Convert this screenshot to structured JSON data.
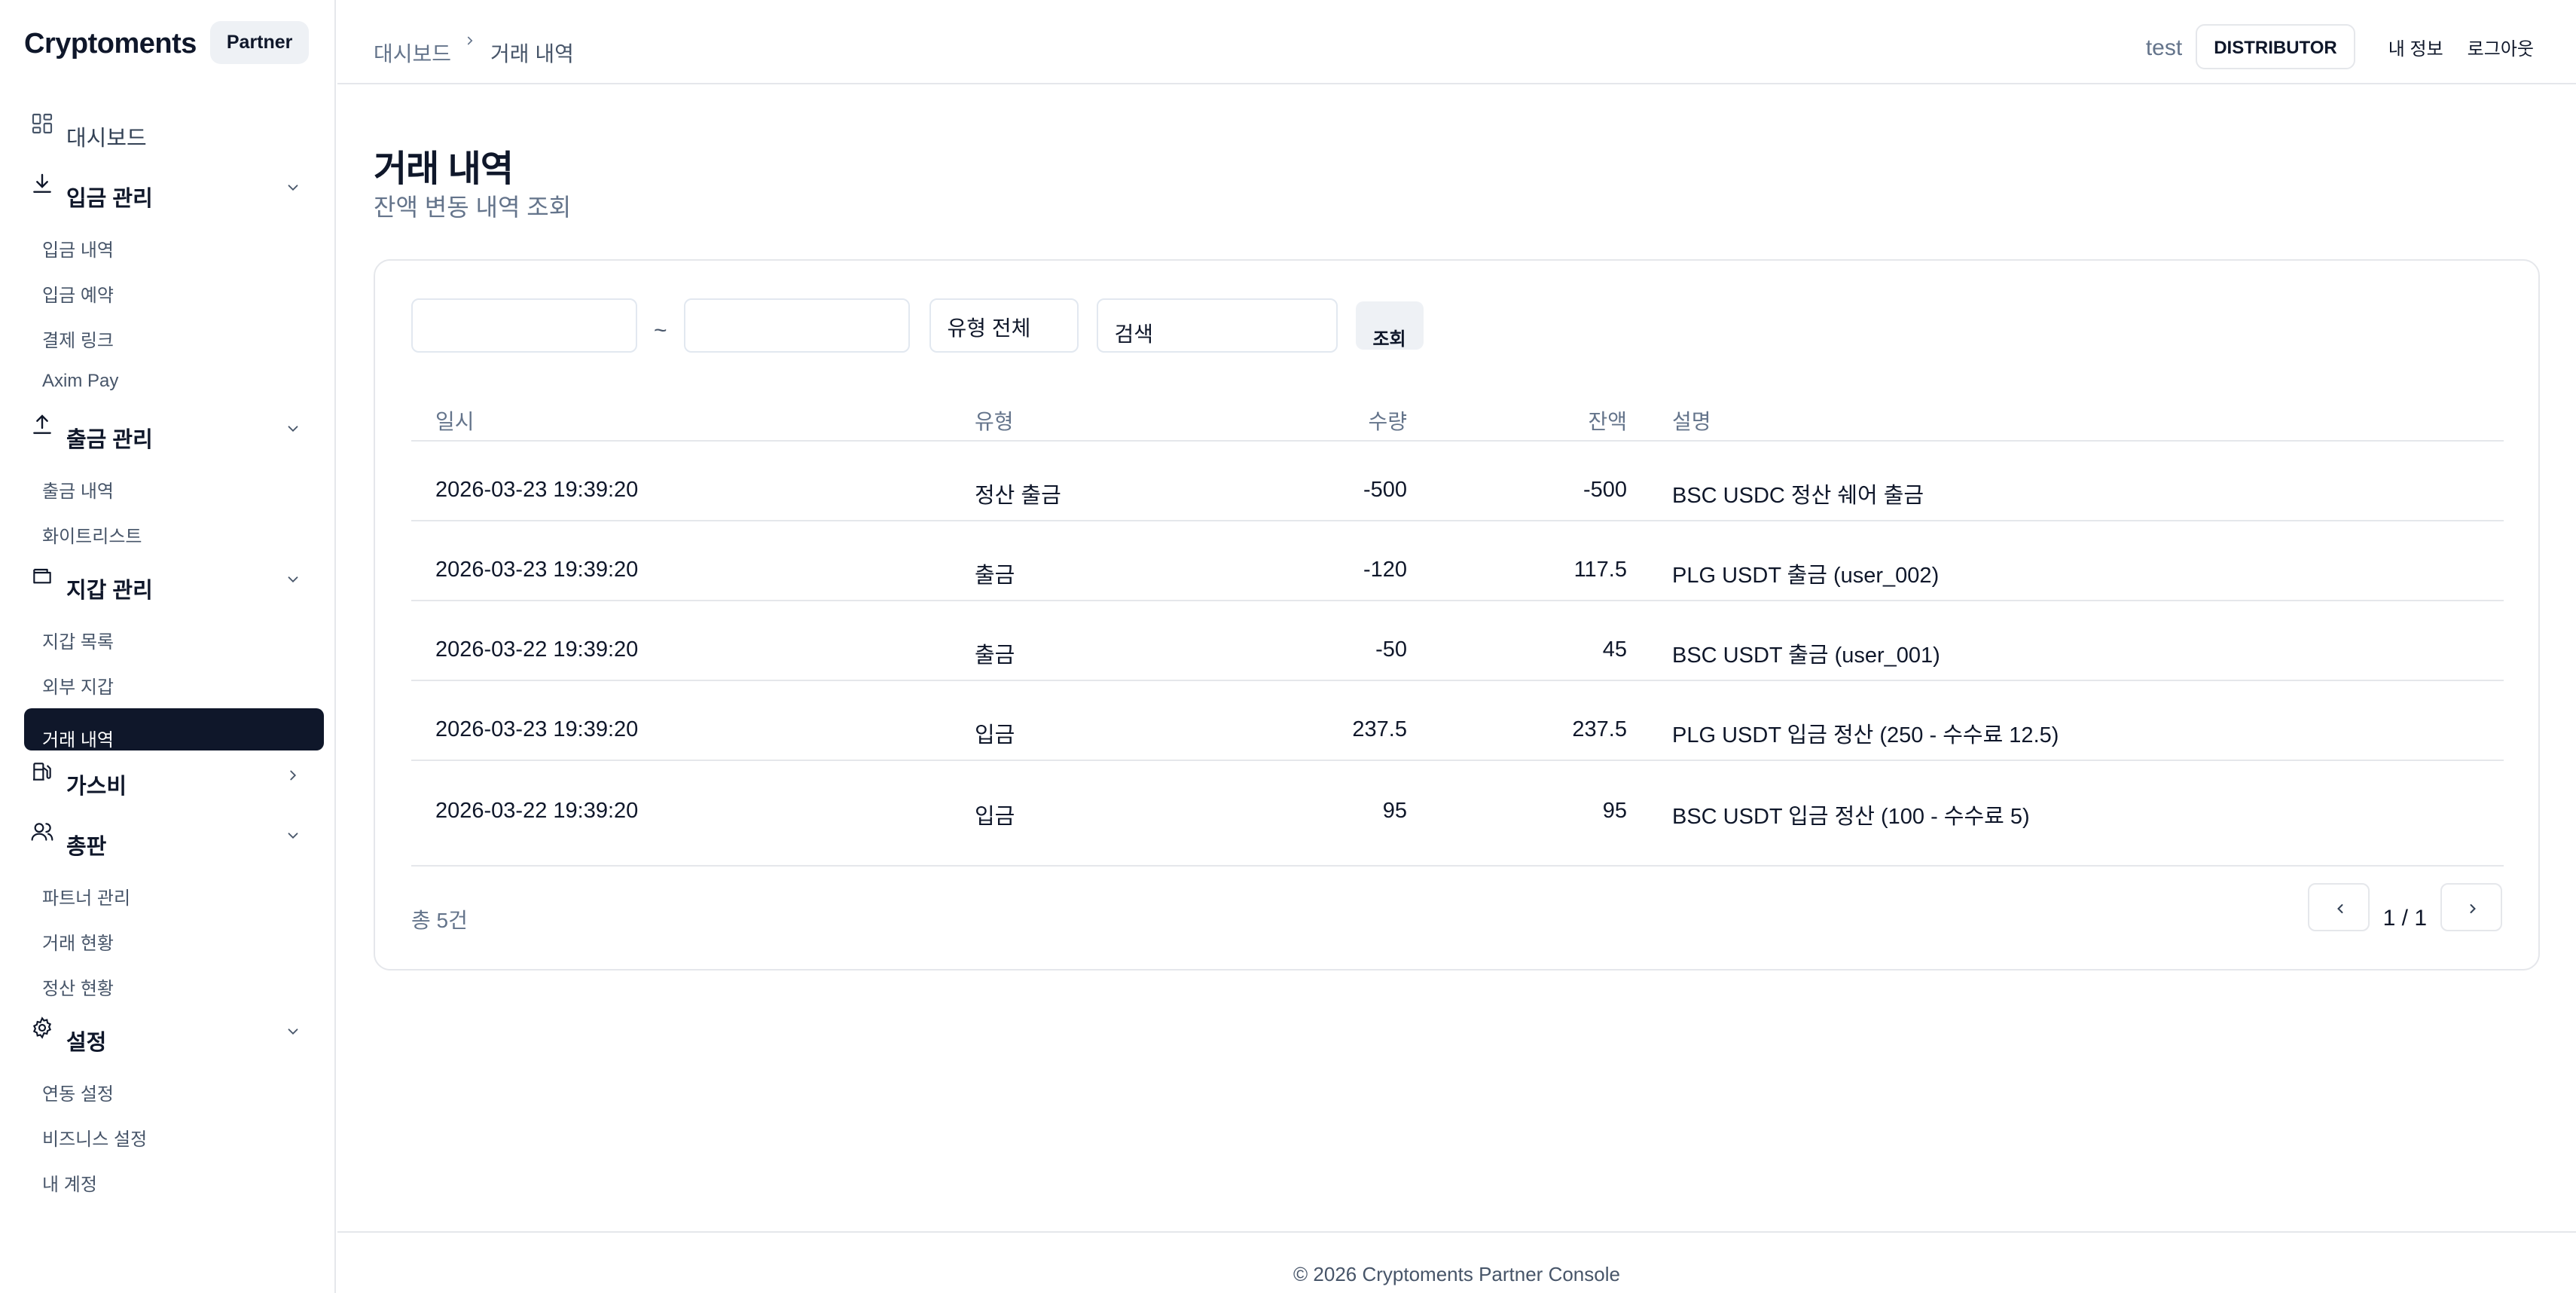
{
  "brand": {
    "name": "Cryptoments",
    "badge": "Partner"
  },
  "sidebar": {
    "dashboard": "대시보드",
    "deposit": {
      "label": "입금 관리",
      "items": [
        "입금 내역",
        "입금 예약",
        "결제 링크",
        "Axim Pay"
      ]
    },
    "withdrawal": {
      "label": "출금 관리",
      "items": [
        "출금 내역",
        "화이트리스트"
      ]
    },
    "wallet": {
      "label": "지갑 관리",
      "items": [
        "지갑 목록",
        "외부 지갑",
        "거래 내역"
      ]
    },
    "gas": {
      "label": "가스비"
    },
    "distributor": {
      "label": "총판",
      "items": [
        "파트너 관리",
        "거래 현황",
        "정산 현황"
      ]
    },
    "settings": {
      "label": "설정",
      "items": [
        "연동 설정",
        "비즈니스 설정",
        "내 계정"
      ]
    }
  },
  "header": {
    "breadcrumb": [
      "대시보드",
      "거래 내역"
    ],
    "user": "test",
    "role": "DISTRIBUTOR",
    "my_info": "내 정보",
    "logout": "로그아웃"
  },
  "page": {
    "title": "거래 내역",
    "subtitle": "잔액 변동 내역 조회"
  },
  "filters": {
    "separator": "~",
    "type_select": "유형 전체",
    "search_value": "검색",
    "search_button": "조회"
  },
  "table": {
    "columns": {
      "date": "일시",
      "type": "유형",
      "amount": "수량",
      "balance": "잔액",
      "description": "설명"
    },
    "rows": [
      {
        "date": "2026-03-23 19:39:20",
        "type": "정산 출금",
        "amount": "-500",
        "balance": "-500",
        "description": "BSC USDC 정산 쉐어 출금"
      },
      {
        "date": "2026-03-23 19:39:20",
        "type": "출금",
        "amount": "-120",
        "balance": "117.5",
        "description": "PLG USDT 출금 (user_002)"
      },
      {
        "date": "2026-03-22 19:39:20",
        "type": "출금",
        "amount": "-50",
        "balance": "45",
        "description": "BSC USDT 출금 (user_001)"
      },
      {
        "date": "2026-03-23 19:39:20",
        "type": "입금",
        "amount": "237.5",
        "balance": "237.5",
        "description": "PLG USDT 입금 정산 (250 - 수수료 12.5)"
      },
      {
        "date": "2026-03-22 19:39:20",
        "type": "입금",
        "amount": "95",
        "balance": "95",
        "description": "BSC USDT 입금 정산 (100 - 수수료 5)"
      }
    ]
  },
  "summary": {
    "total": "총 5건",
    "page_indicator": "1 / 1"
  },
  "footer": {
    "text": "© 2026 Cryptoments Partner Console"
  },
  "icons": {
    "dashboard": "layout-grid-icon",
    "deposit": "download-icon",
    "withdrawal": "upload-icon",
    "wallet": "wallet-icon",
    "gas": "fuel-icon",
    "distributor": "users-icon",
    "settings": "gear-icon"
  },
  "colors": {
    "active_bg": "#0f172a",
    "muted_text": "#64748b",
    "border": "#e5e7eb"
  }
}
